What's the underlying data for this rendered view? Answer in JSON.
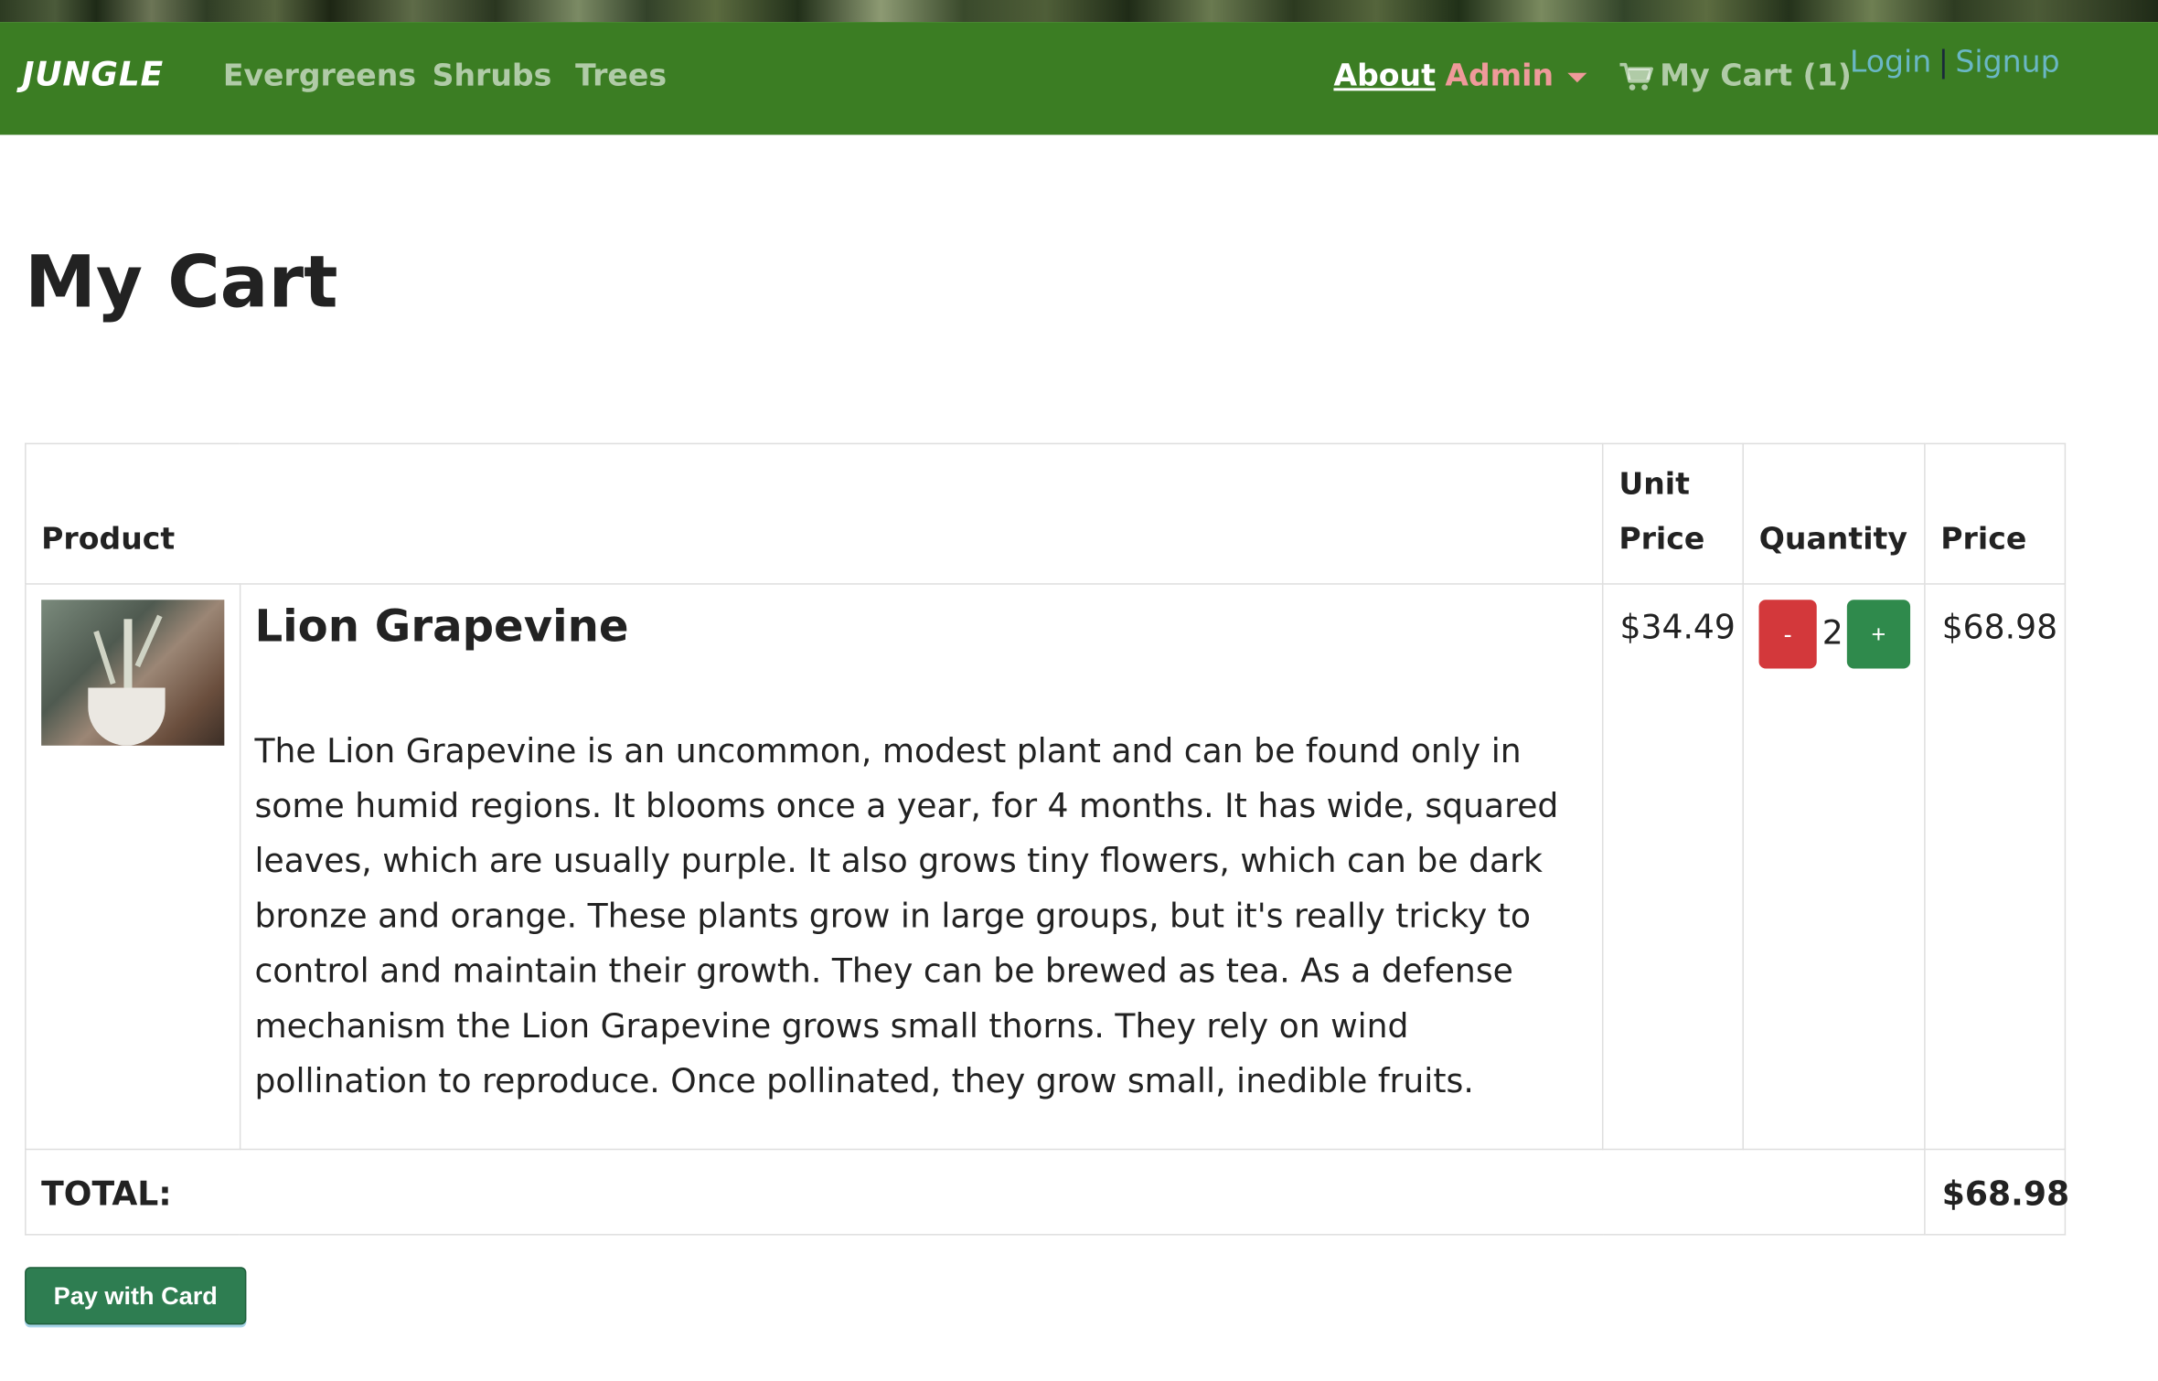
{
  "navbar": {
    "brand": "JUNGLE",
    "links": [
      "Evergreens",
      "Shrubs",
      "Trees"
    ],
    "about": "About",
    "admin": "Admin",
    "cart": "My Cart (1)",
    "login": "Login",
    "signup": "Signup",
    "separator": "|"
  },
  "page": {
    "title": "My Cart"
  },
  "table": {
    "headers": {
      "product": "Product",
      "unit_price_line1": "Unit",
      "unit_price_line2": "Price",
      "quantity": "Quantity",
      "price": "Price"
    },
    "item": {
      "name": "Lion Grapevine",
      "description": "The Lion Grapevine is an uncommon, modest plant and can be found only in some humid regions. It blooms once a year, for 4 months. It has wide, squared leaves, which are usually purple. It also grows tiny flowers, which can be dark bronze and orange. These plants grow in large groups, but it's really tricky to control and maintain their growth. They can be brewed as tea. As a defense mechanism the Lion Grapevine grows small thorns. They rely on wind pollination to reproduce. Once pollinated, they grow small, inedible fruits.",
      "unit_price": "$34.49",
      "quantity": "2",
      "price": "$68.98",
      "minus_label": "-",
      "plus_label": "+"
    },
    "total_label": "TOTAL:",
    "total_value": "$68.98"
  },
  "actions": {
    "pay_label": "Pay with Card"
  },
  "colors": {
    "navbar": "#3b7d23",
    "minus": "#d3383b",
    "plus": "#2f8a4c",
    "pay": "#2e7d51"
  }
}
